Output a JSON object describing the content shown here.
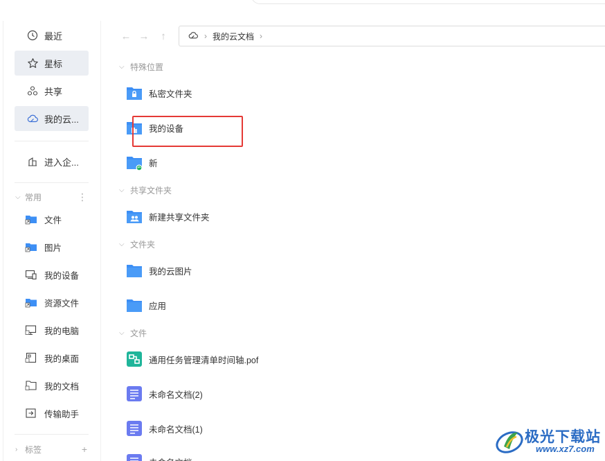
{
  "sidebar": {
    "nav": [
      {
        "label": "最近",
        "icon": "clock-icon"
      },
      {
        "label": "星标",
        "icon": "star-icon"
      },
      {
        "label": "共享",
        "icon": "share-icon"
      },
      {
        "label": "我的云...",
        "icon": "cloud-icon"
      }
    ],
    "enterprise": {
      "label": "进入企...",
      "icon": "building-icon"
    },
    "common_group": {
      "label": "常用",
      "more": "⋮"
    },
    "common_items": [
      {
        "label": "文件",
        "icon": "folder-shortcut-icon"
      },
      {
        "label": "图片",
        "icon": "folder-shortcut-icon"
      },
      {
        "label": "我的设备",
        "icon": "device-icon"
      },
      {
        "label": "资源文件",
        "icon": "folder-shortcut-icon"
      },
      {
        "label": "我的电脑",
        "icon": "monitor-icon"
      },
      {
        "label": "我的桌面",
        "icon": "desktop-icon"
      },
      {
        "label": "我的文档",
        "icon": "document-folder-icon"
      },
      {
        "label": "传输助手",
        "icon": "transfer-icon"
      }
    ],
    "tags_group": {
      "label": "标签",
      "add": "+"
    }
  },
  "toolbar": {
    "back": "←",
    "forward": "→",
    "up": "↑",
    "path": [
      "我的云文档"
    ]
  },
  "content": {
    "sections": [
      {
        "title": "特殊位置",
        "items": [
          {
            "name": "私密文件夹",
            "icon": "private-folder-icon"
          },
          {
            "name": "我的设备",
            "icon": "device-folder-icon"
          },
          {
            "name": "新",
            "icon": "synced-folder-icon"
          }
        ]
      },
      {
        "title": "共享文件夹",
        "items": [
          {
            "name": "新建共享文件夹",
            "icon": "shared-folder-icon"
          }
        ]
      },
      {
        "title": "文件夹",
        "items": [
          {
            "name": "我的云图片",
            "icon": "folder-icon"
          },
          {
            "name": "应用",
            "icon": "folder-icon"
          }
        ]
      },
      {
        "title": "文件",
        "items": [
          {
            "name": "通用任务管理清单时间轴.pof",
            "icon": "mindmap-file-icon"
          },
          {
            "name": "未命名文档(2)",
            "icon": "doc-file-icon"
          },
          {
            "name": "未命名文档(1)",
            "icon": "doc-file-icon"
          },
          {
            "name": "未命名文档",
            "icon": "doc-file-icon"
          }
        ]
      }
    ]
  },
  "watermark": {
    "title": "极光下载站",
    "url": "www.xz7.com"
  },
  "colors": {
    "folder": "#3d8ff5",
    "highlight": "#e53935",
    "active_bg": "#ebeef3",
    "doc": "#6b7bf0",
    "mindmap": "#1fb59a"
  }
}
